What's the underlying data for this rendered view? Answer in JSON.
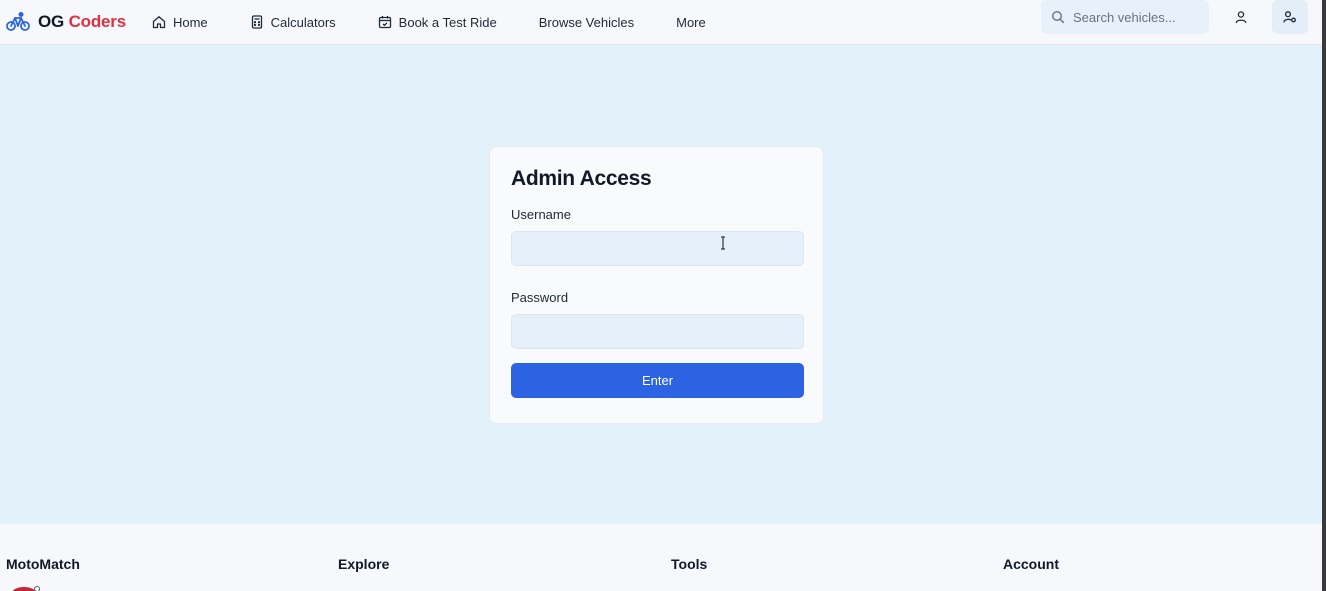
{
  "header": {
    "brand": {
      "part1": "OG",
      "part2": "Coders",
      "accent_color": "#e1303f"
    },
    "nav": [
      {
        "label": "Home",
        "icon": "home-icon"
      },
      {
        "label": "Calculators",
        "icon": "calculator-icon"
      },
      {
        "label": "Book a Test Ride",
        "icon": "calendar-icon"
      },
      {
        "label": "Browse Vehicles",
        "icon": ""
      },
      {
        "label": "More",
        "icon": ""
      }
    ],
    "search": {
      "placeholder": "Search vehicles...",
      "value": ""
    }
  },
  "login": {
    "title": "Admin Access",
    "username_label": "Username",
    "username_value": "",
    "password_label": "Password",
    "password_value": "",
    "submit_label": "Enter",
    "submit_color": "#2b63e3"
  },
  "footer": {
    "columns": [
      "MotoMatch",
      "Explore",
      "Tools",
      "Account"
    ]
  }
}
